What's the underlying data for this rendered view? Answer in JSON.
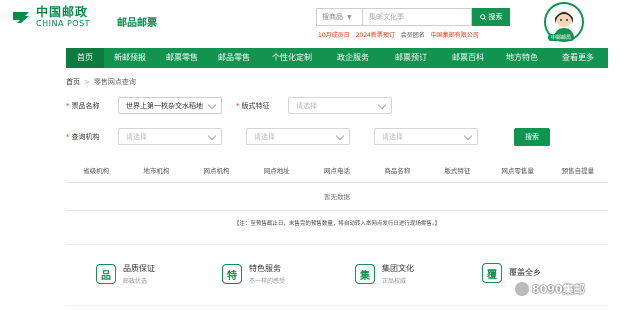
{
  "header": {
    "logo_cn": "中国邮政",
    "logo_en": "CHINA POST",
    "site_title": "邮品邮票",
    "search": {
      "category": "搜商品",
      "placeholder": "集邮文化季",
      "button_label": "搜索"
    },
    "hot_links": [
      "10月成员日",
      "2024新票预订",
      "会员团名",
      "中国集邮有限公司"
    ],
    "avatar_badge": "中邮邮局"
  },
  "nav": {
    "items": [
      "首页",
      "新邮预报",
      "邮票零售",
      "邮品零售",
      "个性化定制",
      "政企服务",
      "邮票预订",
      "邮票百科",
      "地方特色",
      "查看更多"
    ],
    "active_index": 0
  },
  "breadcrumb": {
    "home": "首页",
    "separator": ">",
    "current": "零售网点查询"
  },
  "form": {
    "product_label": "票品名称",
    "product_value": "世界上第一枚杂交水稻地",
    "format_label": "版式特征",
    "format_placeholder": "请选择",
    "org_label": "查询机构",
    "org1_placeholder": "请选择",
    "org2_placeholder": "请选择",
    "org3_placeholder": "请选择",
    "query_button": "搜索"
  },
  "table": {
    "columns": [
      "省级机构",
      "地市机构",
      "网点机构",
      "网点地址",
      "网点电话",
      "商品名称",
      "版式特征",
      "网点零售量",
      "预售自提量"
    ],
    "empty_text": "暂无数据"
  },
  "notice": "【注：至预售截止日，未售完的预售数量，将自动转入本网点发行日进行现场零售。】",
  "features": [
    {
      "icon": "品",
      "title": "品质保证",
      "sub": "邮政优选"
    },
    {
      "icon": "特",
      "title": "特色服务",
      "sub": "不一样的感受"
    },
    {
      "icon": "集",
      "title": "集团文化",
      "sub": "正品权威"
    },
    {
      "icon": "覆",
      "title": "覆盖全乡",
      "sub": ""
    }
  ],
  "watermark": "8090集邮",
  "colors": {
    "brand_green": "#12934f",
    "accent_red": "#e8380d"
  }
}
